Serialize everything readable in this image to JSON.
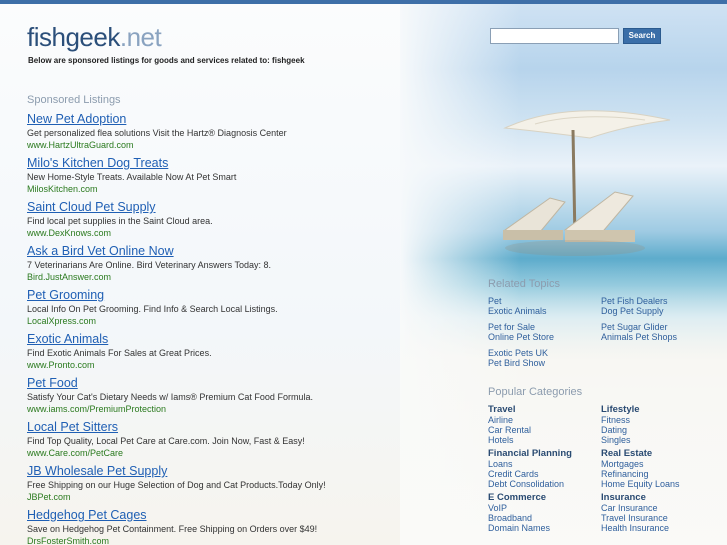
{
  "header": {
    "logo_main": "fishgeek",
    "logo_tld": ".net",
    "tagline": "Below are sponsored listings for goods and services related to: fishgeek",
    "search_placeholder": "",
    "search_button": "Search"
  },
  "sponsored": {
    "heading": "Sponsored Listings",
    "items": [
      {
        "title": "New Pet Adoption",
        "desc": "Get personalized flea solutions Visit the Hartz® Diagnosis Center",
        "url": "www.HartzUltraGuard.com"
      },
      {
        "title": "Milo's Kitchen Dog Treats",
        "desc": "New Home-Style Treats. Available Now At Pet Smart",
        "url": "MilosKitchen.com"
      },
      {
        "title": "Saint Cloud Pet Supply",
        "desc": "Find local pet supplies in the Saint Cloud area.",
        "url": "www.DexKnows.com"
      },
      {
        "title": "Ask a Bird Vet Online Now",
        "desc": "7 Veterinarians Are Online. Bird Veterinary Answers Today: 8.",
        "url": "Bird.JustAnswer.com"
      },
      {
        "title": "Pet Grooming",
        "desc": "Local Info On Pet Grooming. Find Info & Search Local Listings.",
        "url": "LocalXpress.com"
      },
      {
        "title": "Exotic Animals",
        "desc": "Find Exotic Animals For Sales at Great Prices.",
        "url": "www.Pronto.com"
      },
      {
        "title": "Pet Food",
        "desc": "Satisfy Your Cat's Dietary Needs w/ Iams® Premium Cat Food Formula.",
        "url": "www.iams.com/PremiumProtection"
      },
      {
        "title": "Local Pet Sitters",
        "desc": "Find Top Quality, Local Pet Care at Care.com. Join Now, Fast & Easy!",
        "url": "www.Care.com/PetCare"
      },
      {
        "title": "JB Wholesale Pet Supply",
        "desc": "Free Shipping on our Huge Selection of Dog and Cat Products.Today Only!",
        "url": "JBPet.com"
      },
      {
        "title": "Hedgehog Pet Cages",
        "desc": "Save on Hedgehog Pet Containment. Free Shipping on Orders over $49!",
        "url": "DrsFosterSmith.com"
      }
    ]
  },
  "related": {
    "heading": "Related Topics",
    "groups": [
      {
        "left": [
          "Pet",
          "Exotic Animals"
        ],
        "right": [
          "Pet Fish Dealers",
          "Dog Pet Supply"
        ]
      },
      {
        "left": [
          "Pet for Sale",
          "Online Pet Store"
        ],
        "right": [
          "Pet Sugar Glider",
          "Animals Pet Shops"
        ]
      },
      {
        "left": [
          "Exotic Pets UK",
          "Pet Bird Show"
        ],
        "right": []
      }
    ]
  },
  "popular": {
    "heading": "Popular Categories",
    "rows": [
      {
        "left": {
          "title": "Travel",
          "links": [
            "Airline",
            "Car Rental",
            "Hotels"
          ]
        },
        "right": {
          "title": "Lifestyle",
          "links": [
            "Fitness",
            "Dating",
            "Singles"
          ]
        }
      },
      {
        "left": {
          "title": "Financial Planning",
          "links": [
            "Loans",
            "Credit Cards",
            "Debt Consolidation"
          ]
        },
        "right": {
          "title": "Real Estate",
          "links": [
            "Mortgages",
            "Refinancing",
            "Home Equity Loans"
          ]
        }
      },
      {
        "left": {
          "title": "E Commerce",
          "links": [
            "VoIP",
            "Broadband",
            "Domain Names"
          ]
        },
        "right": {
          "title": "Insurance",
          "links": [
            "Car Insurance",
            "Travel Insurance",
            "Health Insurance"
          ]
        }
      }
    ]
  }
}
